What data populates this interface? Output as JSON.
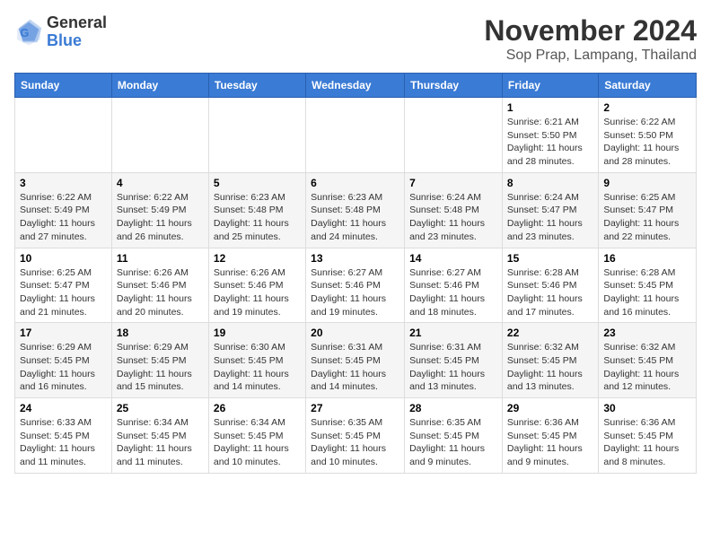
{
  "logo": {
    "general": "General",
    "blue": "Blue"
  },
  "header": {
    "month_year": "November 2024",
    "location": "Sop Prap, Lampang, Thailand"
  },
  "weekdays": [
    "Sunday",
    "Monday",
    "Tuesday",
    "Wednesday",
    "Thursday",
    "Friday",
    "Saturday"
  ],
  "weeks": [
    [
      {
        "day": "",
        "info": ""
      },
      {
        "day": "",
        "info": ""
      },
      {
        "day": "",
        "info": ""
      },
      {
        "day": "",
        "info": ""
      },
      {
        "day": "",
        "info": ""
      },
      {
        "day": "1",
        "info": "Sunrise: 6:21 AM\nSunset: 5:50 PM\nDaylight: 11 hours and 28 minutes."
      },
      {
        "day": "2",
        "info": "Sunrise: 6:22 AM\nSunset: 5:50 PM\nDaylight: 11 hours and 28 minutes."
      }
    ],
    [
      {
        "day": "3",
        "info": "Sunrise: 6:22 AM\nSunset: 5:49 PM\nDaylight: 11 hours and 27 minutes."
      },
      {
        "day": "4",
        "info": "Sunrise: 6:22 AM\nSunset: 5:49 PM\nDaylight: 11 hours and 26 minutes."
      },
      {
        "day": "5",
        "info": "Sunrise: 6:23 AM\nSunset: 5:48 PM\nDaylight: 11 hours and 25 minutes."
      },
      {
        "day": "6",
        "info": "Sunrise: 6:23 AM\nSunset: 5:48 PM\nDaylight: 11 hours and 24 minutes."
      },
      {
        "day": "7",
        "info": "Sunrise: 6:24 AM\nSunset: 5:48 PM\nDaylight: 11 hours and 23 minutes."
      },
      {
        "day": "8",
        "info": "Sunrise: 6:24 AM\nSunset: 5:47 PM\nDaylight: 11 hours and 23 minutes."
      },
      {
        "day": "9",
        "info": "Sunrise: 6:25 AM\nSunset: 5:47 PM\nDaylight: 11 hours and 22 minutes."
      }
    ],
    [
      {
        "day": "10",
        "info": "Sunrise: 6:25 AM\nSunset: 5:47 PM\nDaylight: 11 hours and 21 minutes."
      },
      {
        "day": "11",
        "info": "Sunrise: 6:26 AM\nSunset: 5:46 PM\nDaylight: 11 hours and 20 minutes."
      },
      {
        "day": "12",
        "info": "Sunrise: 6:26 AM\nSunset: 5:46 PM\nDaylight: 11 hours and 19 minutes."
      },
      {
        "day": "13",
        "info": "Sunrise: 6:27 AM\nSunset: 5:46 PM\nDaylight: 11 hours and 19 minutes."
      },
      {
        "day": "14",
        "info": "Sunrise: 6:27 AM\nSunset: 5:46 PM\nDaylight: 11 hours and 18 minutes."
      },
      {
        "day": "15",
        "info": "Sunrise: 6:28 AM\nSunset: 5:46 PM\nDaylight: 11 hours and 17 minutes."
      },
      {
        "day": "16",
        "info": "Sunrise: 6:28 AM\nSunset: 5:45 PM\nDaylight: 11 hours and 16 minutes."
      }
    ],
    [
      {
        "day": "17",
        "info": "Sunrise: 6:29 AM\nSunset: 5:45 PM\nDaylight: 11 hours and 16 minutes."
      },
      {
        "day": "18",
        "info": "Sunrise: 6:29 AM\nSunset: 5:45 PM\nDaylight: 11 hours and 15 minutes."
      },
      {
        "day": "19",
        "info": "Sunrise: 6:30 AM\nSunset: 5:45 PM\nDaylight: 11 hours and 14 minutes."
      },
      {
        "day": "20",
        "info": "Sunrise: 6:31 AM\nSunset: 5:45 PM\nDaylight: 11 hours and 14 minutes."
      },
      {
        "day": "21",
        "info": "Sunrise: 6:31 AM\nSunset: 5:45 PM\nDaylight: 11 hours and 13 minutes."
      },
      {
        "day": "22",
        "info": "Sunrise: 6:32 AM\nSunset: 5:45 PM\nDaylight: 11 hours and 13 minutes."
      },
      {
        "day": "23",
        "info": "Sunrise: 6:32 AM\nSunset: 5:45 PM\nDaylight: 11 hours and 12 minutes."
      }
    ],
    [
      {
        "day": "24",
        "info": "Sunrise: 6:33 AM\nSunset: 5:45 PM\nDaylight: 11 hours and 11 minutes."
      },
      {
        "day": "25",
        "info": "Sunrise: 6:34 AM\nSunset: 5:45 PM\nDaylight: 11 hours and 11 minutes."
      },
      {
        "day": "26",
        "info": "Sunrise: 6:34 AM\nSunset: 5:45 PM\nDaylight: 11 hours and 10 minutes."
      },
      {
        "day": "27",
        "info": "Sunrise: 6:35 AM\nSunset: 5:45 PM\nDaylight: 11 hours and 10 minutes."
      },
      {
        "day": "28",
        "info": "Sunrise: 6:35 AM\nSunset: 5:45 PM\nDaylight: 11 hours and 9 minutes."
      },
      {
        "day": "29",
        "info": "Sunrise: 6:36 AM\nSunset: 5:45 PM\nDaylight: 11 hours and 9 minutes."
      },
      {
        "day": "30",
        "info": "Sunrise: 6:36 AM\nSunset: 5:45 PM\nDaylight: 11 hours and 8 minutes."
      }
    ]
  ]
}
